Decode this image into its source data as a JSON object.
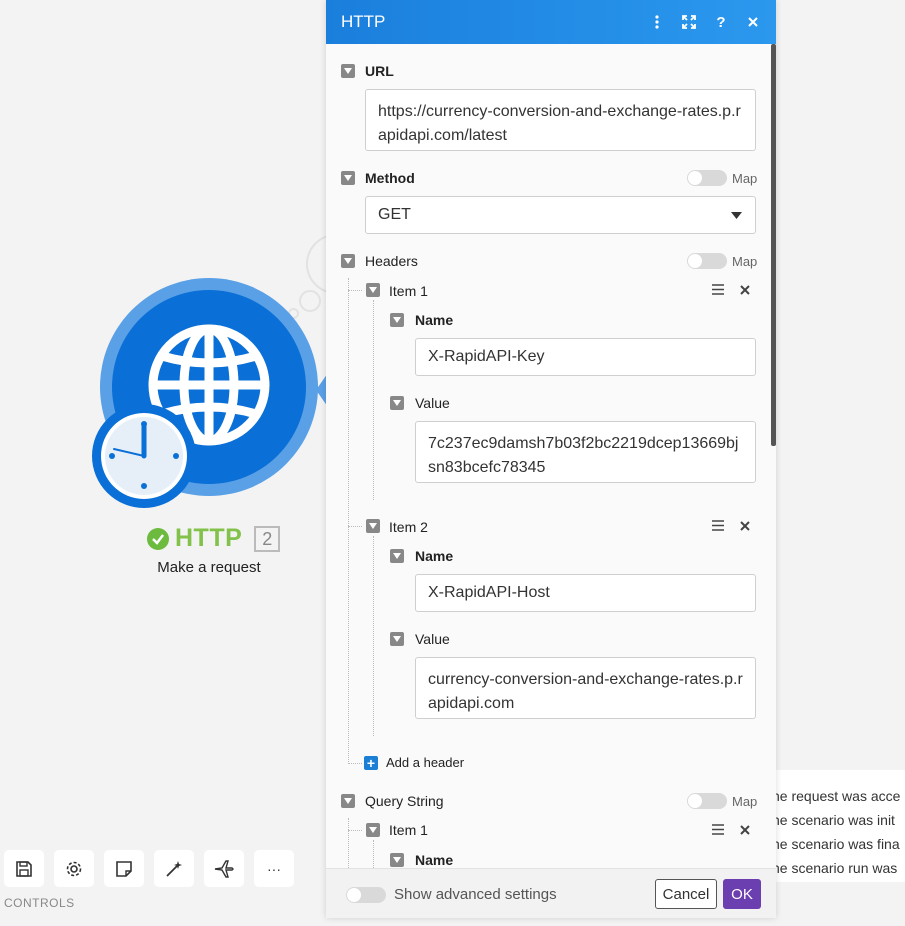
{
  "module": {
    "name": "HTTP",
    "count": "2",
    "subtitle": "Make a request",
    "colors": {
      "primary": "#0a6fd6",
      "ring": "#5aa0e6",
      "status_ok": "#6dbb3e"
    }
  },
  "controls": {
    "label": "CONTROLS",
    "buttons": [
      "save-icon",
      "gear-icon",
      "note-icon",
      "magic-wand-icon",
      "airplane-icon",
      "more-icon"
    ],
    "more_label": "···"
  },
  "logs": {
    "lines": [
      "he request was acce",
      "he scenario was init",
      "he scenario was fina",
      "he scenario run was"
    ]
  },
  "panel": {
    "title": "HTTP",
    "url": {
      "label": "URL",
      "value": "https://currency-conversion-and-exchange-rates.p.rapidapi.com/latest"
    },
    "method": {
      "label": "Method",
      "value": "GET",
      "map_label": "Map"
    },
    "headers": {
      "label": "Headers",
      "map_label": "Map",
      "items": [
        {
          "label": "Item 1",
          "name_label": "Name",
          "name_value": "X-RapidAPI-Key",
          "value_label": "Value",
          "value_value": "7c237ec9damsh7b03f2bc2219dcep13669bjsn83bcefc78345"
        },
        {
          "label": "Item 2",
          "name_label": "Name",
          "name_value": "X-RapidAPI-Host",
          "value_label": "Value",
          "value_value": "currency-conversion-and-exchange-rates.p.rapidapi.com"
        }
      ],
      "add_label": "Add a header"
    },
    "query_string": {
      "label": "Query String",
      "map_label": "Map",
      "items": [
        {
          "label": "Item 1",
          "name_label": "Name"
        }
      ]
    },
    "footer": {
      "advanced_label": "Show advanced settings",
      "cancel_label": "Cancel",
      "ok_label": "OK"
    }
  }
}
